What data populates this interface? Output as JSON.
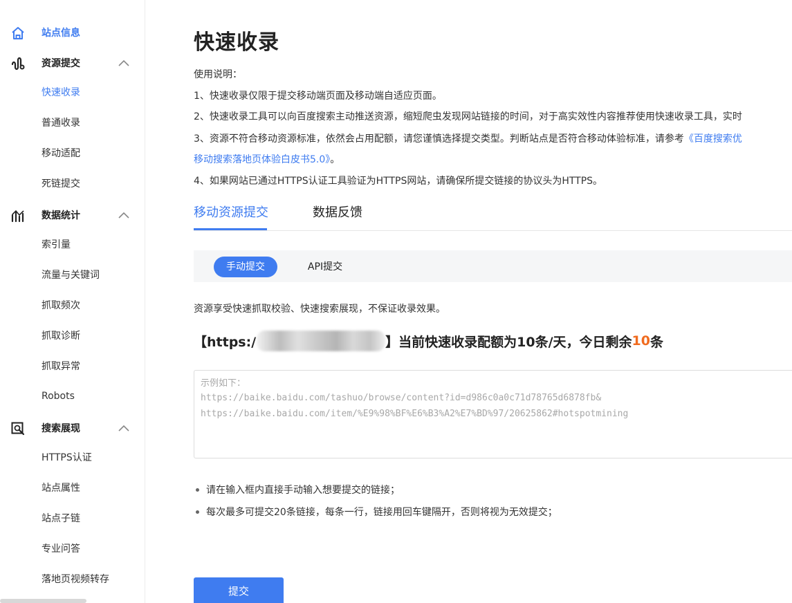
{
  "sidebar": {
    "site_info": "站点信息",
    "groups": [
      {
        "label": "资源提交",
        "icon": "submit-resource-icon",
        "items": [
          "快速收录",
          "普通收录",
          "移动适配",
          "死链提交"
        ],
        "active_item": "快速收录"
      },
      {
        "label": "数据统计",
        "icon": "statistics-icon",
        "items": [
          "索引量",
          "流量与关键词",
          "抓取频次",
          "抓取诊断",
          "抓取异常",
          "Robots"
        ]
      },
      {
        "label": "搜索展现",
        "icon": "search-display-icon",
        "items": [
          "HTTPS认证",
          "站点属性",
          "站点子链",
          "专业问答",
          "落地页视频转存"
        ]
      }
    ]
  },
  "main": {
    "title": "快速收录",
    "instructions": {
      "heading": "使用说明：",
      "line1": "1、快速收录仅限于提交移动端页面及移动端自适应页面。",
      "line2": "2、快速收录工具可以向百度搜索主动推送资源，缩短爬虫发现网站链接的时间，对于高实效性内容推荐使用快速收录工具，实时",
      "line3_prefix": "3、资源不符合移动资源标准，依然会占用配额，请您谨慎选择提交类型。判断站点是否符合移动体验标准，请参考",
      "line3_link": "《百度搜索优",
      "line3_cont_link": "移动搜索落地页体验白皮书5.0》",
      "line3_cont_suffix": "。",
      "line4": "4、如果网站已通过HTTPS认证工具验证为HTTPS网站，请确保所提交链接的协议头为HTTPS。"
    },
    "tabs": [
      "移动资源提交",
      "数据反馈"
    ],
    "mode_buttons": [
      "手动提交",
      "API提交"
    ],
    "description": "资源享受快速抓取校验、快速搜索展现，不保证收录效果。",
    "quota": {
      "prefix": "【https:/",
      "middle": "】当前快速收录配额为10条/天，今日剩余",
      "remaining": "10",
      "suffix": "条"
    },
    "url_input": {
      "placeholder_line1": "示例如下：",
      "placeholder_line2": "https://baike.baidu.com/tashuo/browse/content?id=d986c0a0c71d78765d6878fb&",
      "placeholder_line3": "https://baike.baidu.com/item/%E9%98%BF%E6%B3%A2%E7%BD%97/20625862#hotspotmining"
    },
    "notes": [
      "请在输入框内直接手动输入想要提交的链接；",
      "每次最多可提交20条链接，每条一行，链接用回车键隔开，否则将视为无效提交；"
    ],
    "submit_label": "提交"
  },
  "colors": {
    "accent": "#3f7cf0",
    "highlight": "#f06b1f"
  }
}
